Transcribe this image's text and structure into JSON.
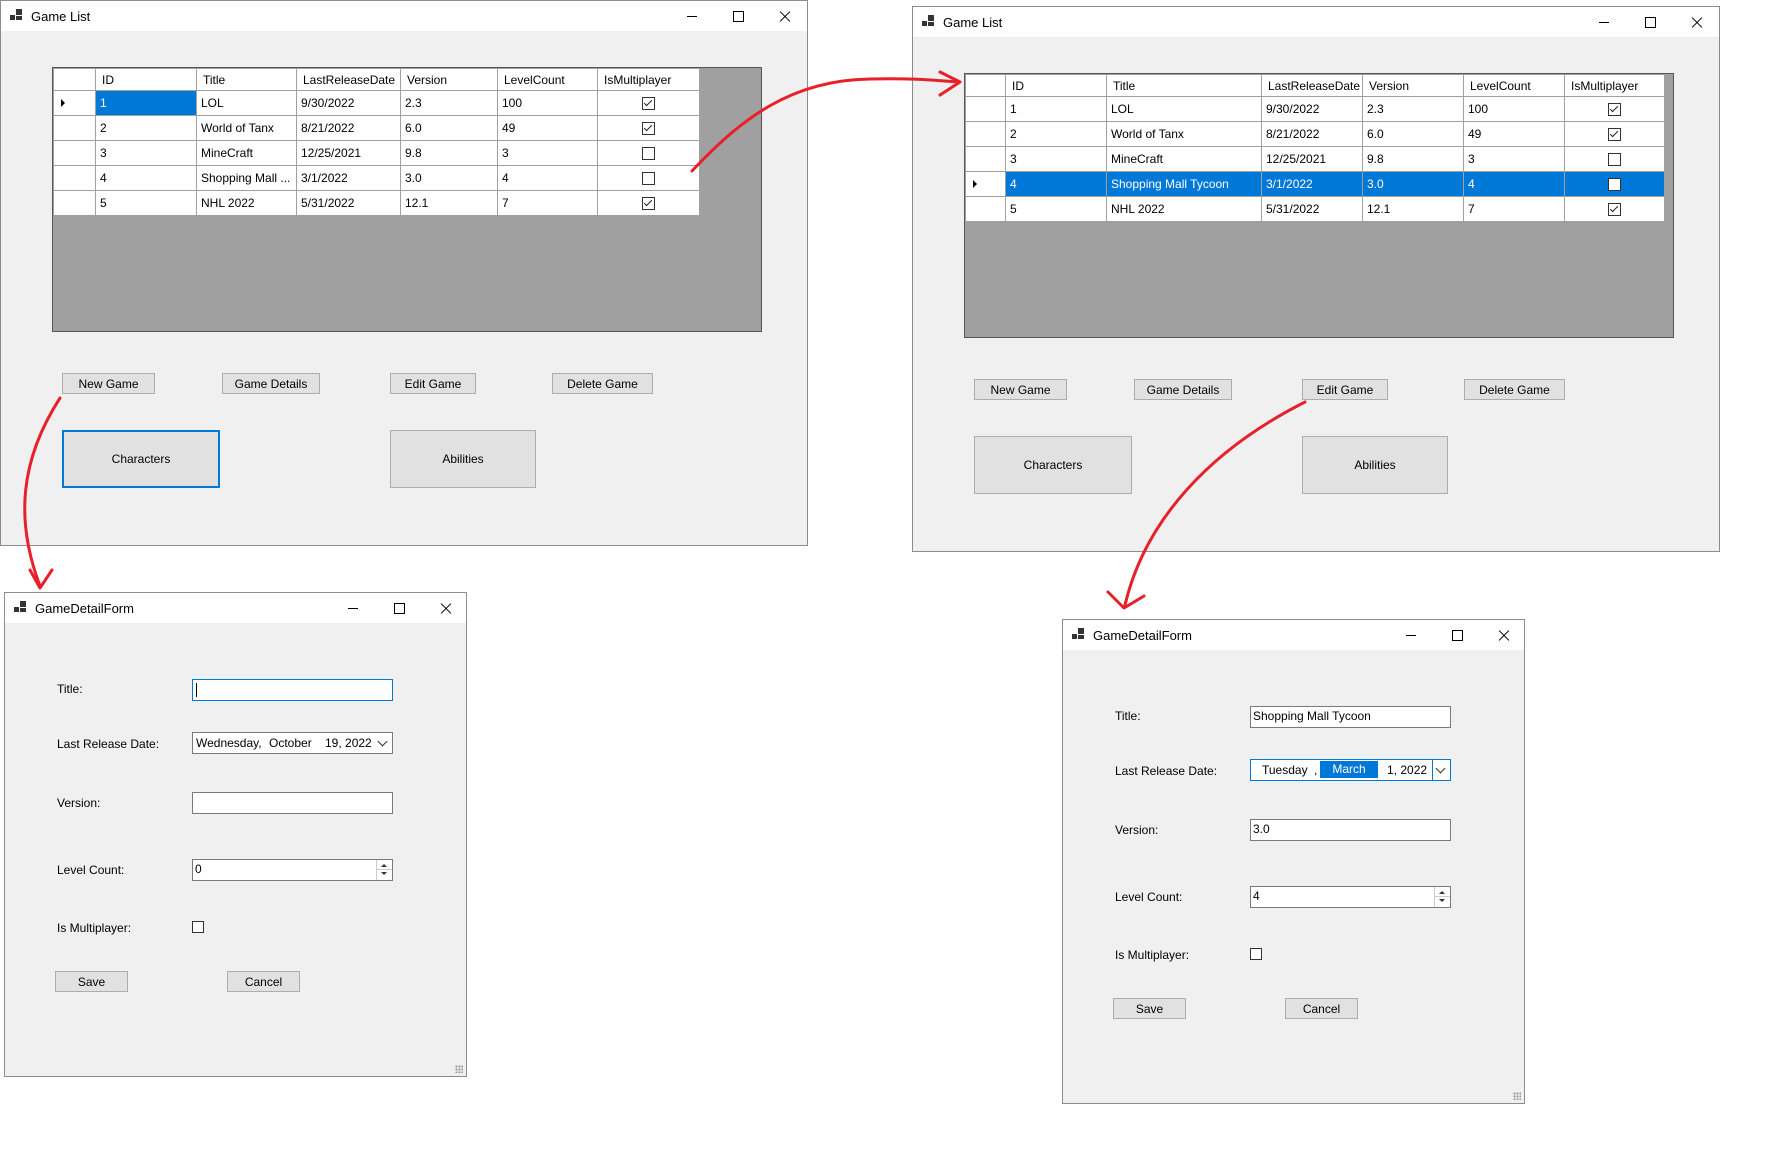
{
  "win1": {
    "title": "Game List",
    "columns": [
      "ID",
      "Title",
      "LastReleaseDate",
      "Version",
      "LevelCount",
      "IsMultiplayer"
    ],
    "rows": [
      {
        "id": "1",
        "title": "LOL",
        "date": "9/30/2022",
        "version": "2.3",
        "levels": "100",
        "multi": true
      },
      {
        "id": "2",
        "title": "World of Tanx",
        "date": "8/21/2022",
        "version": "6.0",
        "levels": "49",
        "multi": true
      },
      {
        "id": "3",
        "title": "MineCraft",
        "date": "12/25/2021",
        "version": "9.8",
        "levels": "3",
        "multi": false
      },
      {
        "id": "4",
        "title": "Shopping Mall ...",
        "date": "3/1/2022",
        "version": "3.0",
        "levels": "4",
        "multi": false
      },
      {
        "id": "5",
        "title": "NHL 2022",
        "date": "5/31/2022",
        "version": "12.1",
        "levels": "7",
        "multi": true
      }
    ],
    "buttons": {
      "new": "New Game",
      "details": "Game Details",
      "edit": "Edit Game",
      "delete": "Delete Game",
      "characters": "Characters",
      "abilities": "Abilities"
    }
  },
  "win2": {
    "title": "Game List",
    "columns": [
      "ID",
      "Title",
      "LastReleaseDate",
      "Version",
      "LevelCount",
      "IsMultiplayer"
    ],
    "rows": [
      {
        "id": "1",
        "title": "LOL",
        "date": "9/30/2022",
        "version": "2.3",
        "levels": "100",
        "multi": true
      },
      {
        "id": "2",
        "title": "World of Tanx",
        "date": "8/21/2022",
        "version": "6.0",
        "levels": "49",
        "multi": true
      },
      {
        "id": "3",
        "title": "MineCraft",
        "date": "12/25/2021",
        "version": "9.8",
        "levels": "3",
        "multi": false
      },
      {
        "id": "4",
        "title": "Shopping Mall Tycoon",
        "date": "3/1/2022",
        "version": "3.0",
        "levels": "4",
        "multi": false
      },
      {
        "id": "5",
        "title": "NHL 2022",
        "date": "5/31/2022",
        "version": "12.1",
        "levels": "7",
        "multi": true
      }
    ],
    "buttons": {
      "new": "New Game",
      "details": "Game Details",
      "edit": "Edit Game",
      "delete": "Delete Game",
      "characters": "Characters",
      "abilities": "Abilities"
    }
  },
  "form1": {
    "title": "GameDetailForm",
    "labels": {
      "title": "Title:",
      "date": "Last Release Date:",
      "version": "Version:",
      "levels": "Level Count:",
      "multi": "Is Multiplayer:"
    },
    "values": {
      "title": "",
      "date_day": "Wednesday,",
      "date_month": "October",
      "date_rest": "19, 2022",
      "version": "",
      "levels": "0"
    },
    "buttons": {
      "save": "Save",
      "cancel": "Cancel"
    }
  },
  "form2": {
    "title": "GameDetailForm",
    "labels": {
      "title": "Title:",
      "date": "Last Release Date:",
      "version": "Version:",
      "levels": "Level Count:",
      "multi": "Is Multiplayer:"
    },
    "values": {
      "title": "Shopping Mall Tycoon",
      "date_day": "Tuesday",
      "date_sep": ",",
      "date_month": "March",
      "date_rest": "1, 2022",
      "version": "3.0",
      "levels": "4"
    },
    "buttons": {
      "save": "Save",
      "cancel": "Cancel"
    }
  },
  "colors": {
    "annotation_arrow": "#e8202a",
    "selection": "#0078d7"
  }
}
